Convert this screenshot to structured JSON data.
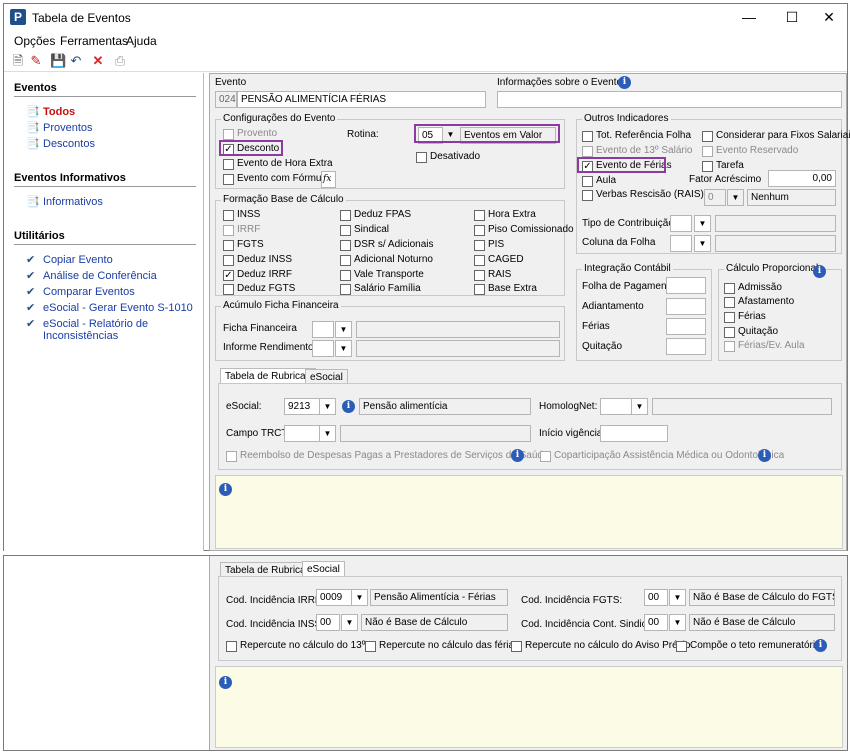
{
  "window": {
    "title": "Tabela de Eventos"
  },
  "menu": [
    "Opções",
    "Ferramentas",
    "Ajuda"
  ],
  "sidebar": {
    "eventos_title": "Eventos",
    "eventos": [
      "Todos",
      "Proventos",
      "Descontos"
    ],
    "informativos_title": "Eventos Informativos",
    "informativos": [
      "Informativos"
    ],
    "utilitarios_title": "Utilitários",
    "utilitarios": [
      "Copiar Evento",
      "Análise de Conferência",
      "Comparar Eventos",
      "eSocial - Gerar Evento S-1010",
      "eSocial - Relatório de",
      "Inconsistências"
    ]
  },
  "evento": {
    "label": "Evento",
    "code": "024",
    "name": "PENSÃO ALIMENTÍCIA FÉRIAS",
    "info_label": "Informações sobre o Evento"
  },
  "config": {
    "title": "Configurações do Evento",
    "provento": "Provento",
    "desconto": "Desconto",
    "hora_extra": "Evento de Hora Extra",
    "formula": "Evento com Fórmula",
    "fx": "fx",
    "rotina_label": "Rotina:",
    "rotina_code": "05",
    "rotina_name": "Eventos em Valor",
    "desativado": "Desativado"
  },
  "formacao": {
    "title": "Formação Base de Cálculo",
    "col1": [
      "INSS",
      "IRRF",
      "FGTS",
      "Deduz INSS",
      "Deduz IRRF",
      "Deduz FGTS"
    ],
    "col2": [
      "Deduz FPAS",
      "Sindical",
      "DSR s/ Adicionais",
      "Adicional Noturno",
      "Vale Transporte",
      "Salário Família"
    ],
    "col3": [
      "Hora Extra",
      "Piso Comissionado",
      "PIS",
      "CAGED",
      "RAIS",
      "Base Extra"
    ]
  },
  "acumulo": {
    "title": "Acúmulo Ficha Financeira",
    "ficha": "Ficha Financeira",
    "informe": "Informe Rendimentos"
  },
  "outros": {
    "title": "Outros Indicadores",
    "items_left": [
      "Tot. Referência Folha",
      "Evento de 13º Salário",
      "Evento de Férias",
      "Aula",
      "Verbas Rescisão (RAIS)"
    ],
    "items_right": [
      "Considerar para Fixos Salariais",
      "Evento Reservado",
      "Tarefa"
    ],
    "fator_label": "Fator Acréscimo",
    "fator_value": "0,00",
    "verbas_code": "0",
    "verbas_name": "Nenhum",
    "tipo_contrib": "Tipo de Contribuição",
    "coluna_folha": "Coluna da Folha"
  },
  "integracao": {
    "title": "Integração Contábil",
    "items": [
      "Folha de Pagamento",
      "Adiantamento",
      "Férias",
      "Quitação"
    ]
  },
  "proporcional": {
    "title": "Cálculo Proporcional",
    "items": [
      "Admissão",
      "Afastamento",
      "Férias",
      "Quitação",
      "Férias/Ev. Aula"
    ]
  },
  "tabs": [
    "Tabela de Rubricas",
    "eSocial"
  ],
  "rubricas": {
    "esocial_label": "eSocial:",
    "esocial_code": "9213",
    "esocial_name": "Pensão alimentícia",
    "homolog_label": "HomologNet:",
    "campo_trct": "Campo TRCT:",
    "inicio_vigencia": "Início vigência:",
    "reembolso": "Reembolso de Despesas Pagas a Prestadores de Serviços de Saúde",
    "coparticipacao": "Coparticipação Assistência Médica ou Odontológica"
  },
  "esocial": {
    "irrf_label": "Cod. Incidência IRRF:",
    "irrf_code": "0009",
    "irrf_name": "Pensão Alimentícia - Férias",
    "fgts_label": "Cod. Incidência FGTS:",
    "fgts_code": "00",
    "fgts_name": "Não é Base de Cálculo do FGTS",
    "inss_label": "Cod. Incidência INSS:",
    "inss_code": "00",
    "inss_name": "Não é Base de Cálculo",
    "sind_label": "Cod. Incidência Cont. Sindical:",
    "sind_code": "00",
    "sind_name": "Não é Base de Cálculo",
    "rep13": "Repercute no cálculo do 13º",
    "repferias": "Repercute no cálculo das férias",
    "repaviso": "Repercute no cálculo do Aviso Prévio",
    "teto": "Compõe o teto remuneratório"
  }
}
